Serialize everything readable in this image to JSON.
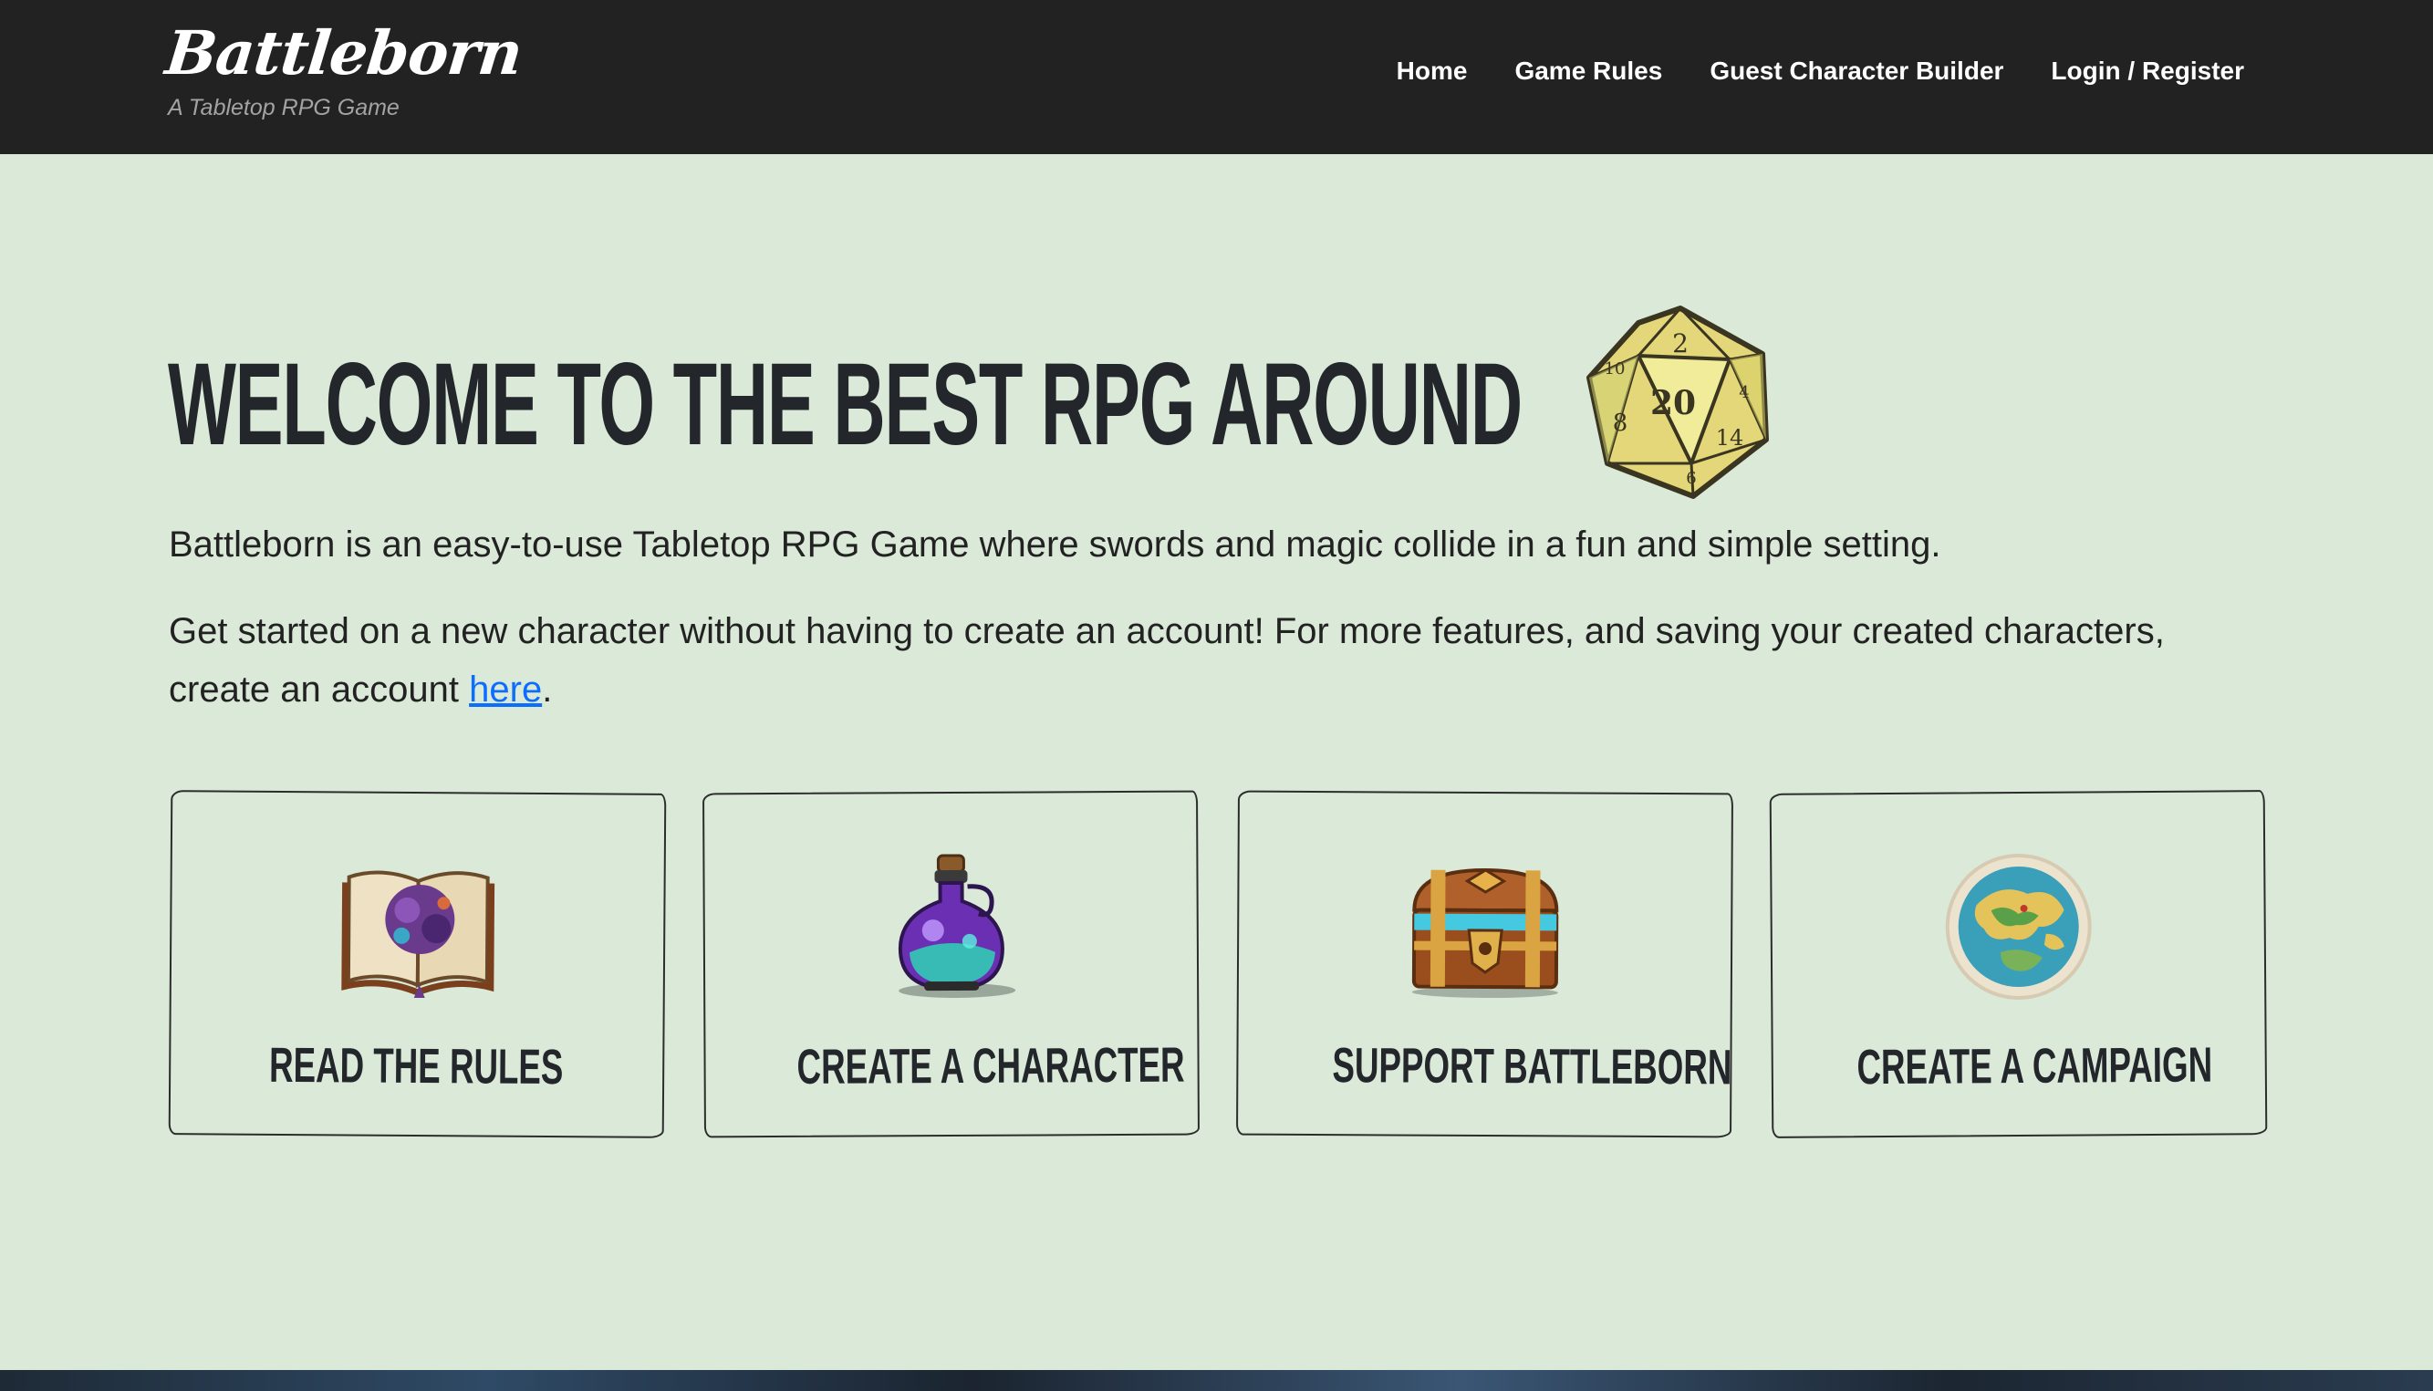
{
  "header": {
    "logo_text": "Battleborn",
    "tagline": "A Tabletop RPG Game",
    "nav": [
      {
        "label": "Home"
      },
      {
        "label": "Game Rules"
      },
      {
        "label": "Guest Character Builder"
      },
      {
        "label": "Login / Register"
      }
    ]
  },
  "main": {
    "title": "WELCOME TO THE BEST RPG AROUND",
    "title_icon": "d20-dice-icon",
    "intro": "Battleborn is an easy-to-use Tabletop RPG Game where swords and magic collide in a fun and simple setting.",
    "cta_text": "Get started on a new character without having to create an account! For more features, and saving your created characters, create an account",
    "cta_link": "here",
    "cta_end": "."
  },
  "cards": [
    {
      "label": "READ THE RULES",
      "icon": "spellbook-icon"
    },
    {
      "label": "CREATE A CHARACTER",
      "icon": "potion-icon"
    },
    {
      "label": "SUPPORT BATTLEBORN",
      "icon": "treasure-chest-icon"
    },
    {
      "label": "CREATE A CAMPAIGN",
      "icon": "world-map-icon"
    }
  ],
  "colors": {
    "header_bg": "#222222",
    "page_bg": "#dbe9d9",
    "title": "#23272b",
    "link": "#0d6efd"
  }
}
